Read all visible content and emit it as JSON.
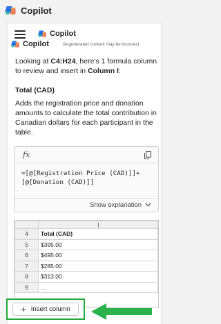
{
  "app": {
    "title": "Copilot"
  },
  "subheader": {
    "title_primary": "Copilot",
    "title_secondary": "Copilot",
    "disclaimer": "AI-generated content may be incorrect"
  },
  "message": {
    "intro_before_range": "Looking at ",
    "range": "C4:H24",
    "intro_middle": ", here's 1 formula column to review and insert in ",
    "column_target": "Column I",
    "intro_end": ":",
    "heading": "Total (CAD)",
    "description": "Adds the registration price and donation amounts to calculate the total contribution in Canadian dollars for each participant in the table."
  },
  "formula": {
    "fx_label": "fx",
    "line1": "=[@[Registration Price (CAD)]]+",
    "line2": "[@[Donation (CAD)]]",
    "show_explanation": "Show explanation"
  },
  "preview": {
    "column_header": "",
    "rows": [
      {
        "num": "4",
        "value": "Total (CAD)"
      },
      {
        "num": "5",
        "value": "$395.00"
      },
      {
        "num": "6",
        "value": "$495.00"
      },
      {
        "num": "7",
        "value": "$285.00"
      },
      {
        "num": "8",
        "value": "$313.00"
      },
      {
        "num": "9",
        "value": "..."
      }
    ]
  },
  "actions": {
    "insert_column": "Insert column"
  },
  "colors": {
    "highlight_green": "#22a83a",
    "arrow_green": "#2bb24c"
  }
}
